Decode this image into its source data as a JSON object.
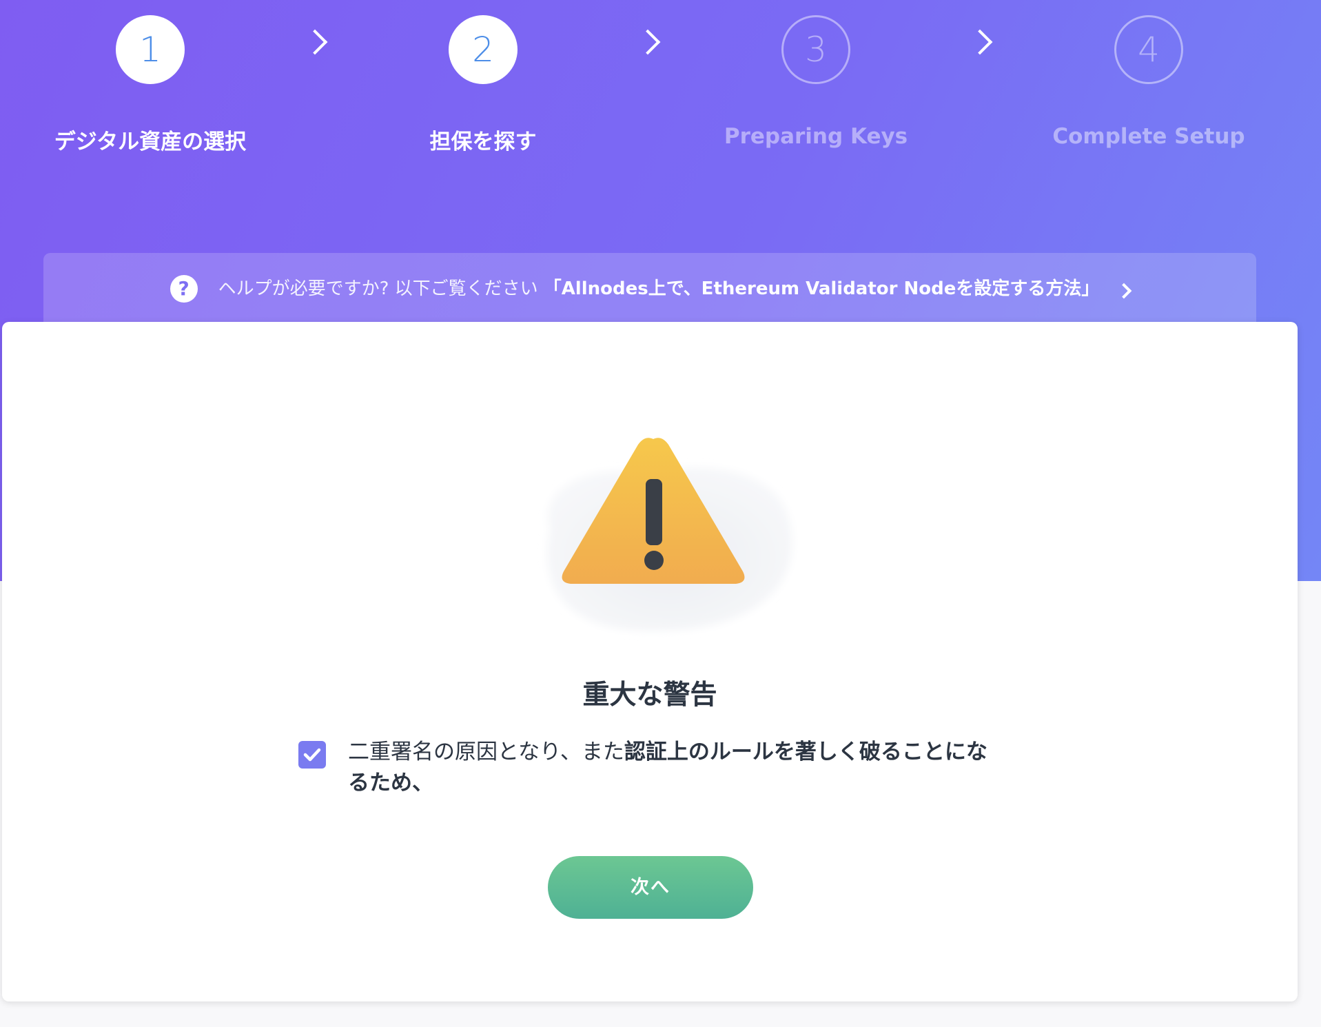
{
  "stepper": {
    "steps": [
      {
        "number": "1",
        "label": "デジタル資産の選択",
        "state": "complete"
      },
      {
        "number": "2",
        "label": "担保を探す",
        "state": "active"
      },
      {
        "number": "3",
        "label": "Preparing Keys",
        "state": "pending"
      },
      {
        "number": "4",
        "label": "Complete Setup",
        "state": "pending"
      }
    ]
  },
  "help": {
    "icon": "help-circle-icon",
    "text": "ヘルプが必要ですか? 以下ご覧ください",
    "link_label": "「Allnodes上で、Ethereum Validator Nodeを設定する方法」"
  },
  "card": {
    "icon": "warning-triangle-icon",
    "title": "重大な警告",
    "checkbox_checked": true,
    "message_plain": "二重署名の原因となり、また",
    "message_bold": "認証上のルールを著しく破ることになるため、",
    "next_label": "次へ"
  },
  "colors": {
    "hero_start": "#7f5df2",
    "hero_end": "#7486f6",
    "accent_blue": "#4d8ee8",
    "checkbox": "#7a7bf0",
    "button_green": "#5cbb94",
    "warning_yellow": "#f3b94a",
    "text_dark": "#2c3542"
  }
}
